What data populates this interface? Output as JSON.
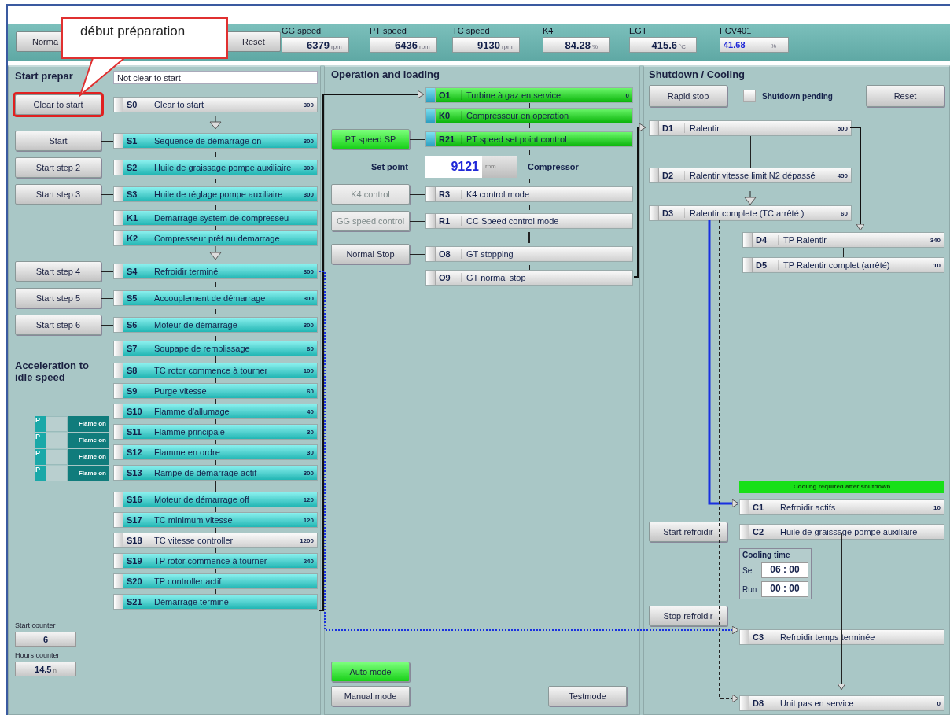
{
  "callout": {
    "text": "début préparation"
  },
  "header": {
    "buttons": [
      {
        "label": "Norma"
      },
      {
        "label": "Reset"
      }
    ],
    "readouts": [
      {
        "label": "GG speed",
        "value": "6379",
        "unit": "rpm",
        "editable": false
      },
      {
        "label": "PT speed",
        "value": "6436",
        "unit": "rpm",
        "editable": false
      },
      {
        "label": "TC speed",
        "value": "9130",
        "unit": "rpm",
        "editable": false
      },
      {
        "label": "K4",
        "value": "84.28",
        "unit": "%",
        "editable": false
      },
      {
        "label": "EGT",
        "value": "415.6",
        "unit": "°C",
        "editable": false
      },
      {
        "label": "FCV401",
        "value": "41.68",
        "unit": "%",
        "editable": true
      }
    ]
  },
  "start_preparation": {
    "title": "Start prepar",
    "status": "Not clear to start",
    "rows": [
      {
        "button": {
          "label": "Clear to start",
          "highlighted": true
        },
        "step": {
          "code": "S0",
          "label": "Clear to start",
          "value": "300",
          "active": false,
          "checked": false
        }
      },
      {
        "arrow_before": true,
        "button": {
          "label": "Start",
          "highlighted": false
        },
        "step": {
          "code": "S1",
          "label": "Sequence de démarrage on",
          "value": "300",
          "active": true,
          "checked": false
        }
      },
      {
        "button": {
          "label": "Start step 2",
          "highlighted": false
        },
        "step": {
          "code": "S2",
          "label": "Huile de graissage pompe auxiliaire",
          "value": "300",
          "active": true,
          "checked": false
        }
      },
      {
        "button": {
          "label": "Start step 3",
          "highlighted": false
        },
        "step": {
          "code": "S3",
          "label": "Huile de réglage pompe auxiliaire",
          "value": "300",
          "active": true,
          "checked": false
        }
      },
      {
        "step": {
          "code": "K1",
          "label": "Demarrage system de compresseu",
          "active": true,
          "checked": false
        }
      },
      {
        "step": {
          "code": "K2",
          "label": "Compresseur prêt au demarrage",
          "active": true,
          "checked": false
        }
      },
      {
        "arrow_before": true,
        "button": {
          "label": "Start step 4",
          "highlighted": false
        },
        "step": {
          "code": "S4",
          "label": "Refroidir terminé",
          "value": "300",
          "active": true,
          "checked": false
        }
      },
      {
        "button": {
          "label": "Start step 5",
          "highlighted": false
        },
        "step": {
          "code": "S5",
          "label": "Accouplement de démarrage",
          "value": "300",
          "active": true,
          "checked": false
        }
      },
      {
        "button": {
          "label": "Start step 6",
          "highlighted": false
        },
        "step": {
          "code": "S6",
          "label": "Moteur de démarrage",
          "value": "300",
          "active": true,
          "checked": false
        }
      },
      {
        "step": {
          "code": "S7",
          "label": "Soupape de remplissage",
          "value": "60",
          "active": true,
          "checked": false
        }
      }
    ]
  },
  "acceleration": {
    "title": "Acceleration to idle speed",
    "flames": [
      {
        "tag": "P",
        "label": "Flame on"
      },
      {
        "tag": "P",
        "label": "Flame on"
      },
      {
        "tag": "P",
        "label": "Flame on"
      },
      {
        "tag": "P",
        "label": "Flame on"
      }
    ],
    "steps": [
      {
        "code": "S8",
        "label": "TC rotor commence à tourner",
        "value": "100",
        "active": true,
        "checked": false
      },
      {
        "code": "S9",
        "label": "Purge vitesse",
        "value": "60",
        "active": true,
        "checked": false
      },
      {
        "code": "S10",
        "label": "Flamme d'allumage",
        "value": "40",
        "active": true,
        "checked": false
      },
      {
        "code": "S11",
        "label": "Flamme principale",
        "value": "30",
        "active": true,
        "checked": false
      },
      {
        "code": "S12",
        "label": "Flamme en ordre",
        "value": "30",
        "active": true,
        "checked": false
      },
      {
        "code": "S13",
        "label": "Rampe de démarrage actif",
        "value": "300",
        "active": true,
        "checked": false
      },
      {
        "gap_before": true,
        "code": "S16",
        "label": "Moteur de démarrage off",
        "value": "120",
        "active": true,
        "checked": false
      },
      {
        "code": "S17",
        "label": "TC minimum vitesse",
        "value": "120",
        "active": true,
        "checked": false
      },
      {
        "code": "S18",
        "label": "TC vitesse controller",
        "value": "1200",
        "active": false,
        "checked": false
      },
      {
        "code": "S19",
        "label": "TP rotor commence à tourner",
        "value": "240",
        "active": true,
        "checked": false
      },
      {
        "code": "S20",
        "label": "TP controller actif",
        "active": true,
        "checked": false
      },
      {
        "code": "S21",
        "label": "Démarrage terminé",
        "active": true,
        "checked": false
      }
    ],
    "counters": [
      {
        "label": "Start counter",
        "value": "6"
      },
      {
        "label": "Hours counter",
        "value": "14.5",
        "unit": "h"
      }
    ]
  },
  "operation": {
    "title": "Operation and loading",
    "rows": [
      {
        "kind": "step",
        "step": {
          "code": "O1",
          "label": "Turbine à gaz en service",
          "value": "0",
          "active": true,
          "checked": true
        }
      },
      {
        "kind": "step",
        "step": {
          "code": "K0",
          "label": "Compresseur en operation",
          "active": true,
          "checked": true
        }
      },
      {
        "kind": "step",
        "button": {
          "label": "PT speed SP",
          "active": true,
          "disabled": false
        },
        "step": {
          "code": "R21",
          "label": "PT speed set point control",
          "active": true,
          "checked": true
        }
      },
      {
        "kind": "setpoint",
        "label": "Set point",
        "value": "9121",
        "unit": "rpm",
        "note": "Compressor"
      },
      {
        "kind": "step",
        "button": {
          "label": "K4 control",
          "active": false,
          "disabled": true
        },
        "step": {
          "code": "R3",
          "label": "K4 control mode",
          "active": false,
          "checked": false
        }
      },
      {
        "kind": "step",
        "button": {
          "label": "GG speed control",
          "active": false,
          "disabled": true
        },
        "step": {
          "code": "R1",
          "label": "CC Speed control mode",
          "active": false,
          "checked": false
        }
      },
      {
        "kind": "step",
        "gap_before": true,
        "button": {
          "label": "Normal Stop",
          "active": false,
          "disabled": false
        },
        "step": {
          "code": "O8",
          "label": "GT stopping",
          "active": false,
          "checked": false
        }
      },
      {
        "kind": "step",
        "step": {
          "code": "O9",
          "label": "GT normal stop",
          "active": false,
          "checked": false
        }
      }
    ],
    "modes": [
      {
        "label": "Auto mode",
        "selected": true
      },
      {
        "label": "Manual mode",
        "selected": false
      }
    ],
    "test_button": "Testmode"
  },
  "shutdown": {
    "title": "Shutdown / Cooling",
    "rapid_stop": "Rapid stop",
    "pending": {
      "label": "Shutdown pending",
      "checked": false
    },
    "reset": "Reset",
    "steps": [
      {
        "code": "D1",
        "label": "Ralentir",
        "value": "500",
        "active": false,
        "checked": false
      },
      {
        "code": "D2",
        "label": "Ralentir vitesse limit N2 dépassé",
        "value": "450",
        "active": false,
        "checked": false
      },
      {
        "arrow_before": true,
        "code": "D3",
        "label": "Ralentir complete (TC arrêté )",
        "value": "60",
        "active": false,
        "checked": false
      }
    ],
    "branch_steps": [
      {
        "code": "D4",
        "label": "TP Ralentir",
        "value": "340",
        "active": false,
        "checked": false
      },
      {
        "code": "D5",
        "label": "TP Ralentir complet (arrêté)",
        "value": "10",
        "active": false,
        "checked": false
      }
    ]
  },
  "cooling": {
    "banner": "Cooling required after shutdown",
    "c1": {
      "code": "C1",
      "label": "Refroidir actifs",
      "value": "10",
      "active": false,
      "checked": false
    },
    "start_button": "Start refroidir",
    "c2": {
      "code": "C2",
      "label": "Huile de graissage pompe auxiliaire",
      "active": false,
      "checked": false
    },
    "cooling_time": {
      "title": "Cooling time",
      "set_label": "Set",
      "set_value": "06 : 00",
      "run_label": "Run",
      "run_value": "00 : 00"
    },
    "stop_button": "Stop refroidir",
    "c3": {
      "code": "C3",
      "label": "Refroidir temps terminée",
      "active": false,
      "checked": false
    },
    "final": {
      "code": "D8",
      "label": "Unit pas en service",
      "value": "0",
      "active": false,
      "checked": false
    }
  }
}
